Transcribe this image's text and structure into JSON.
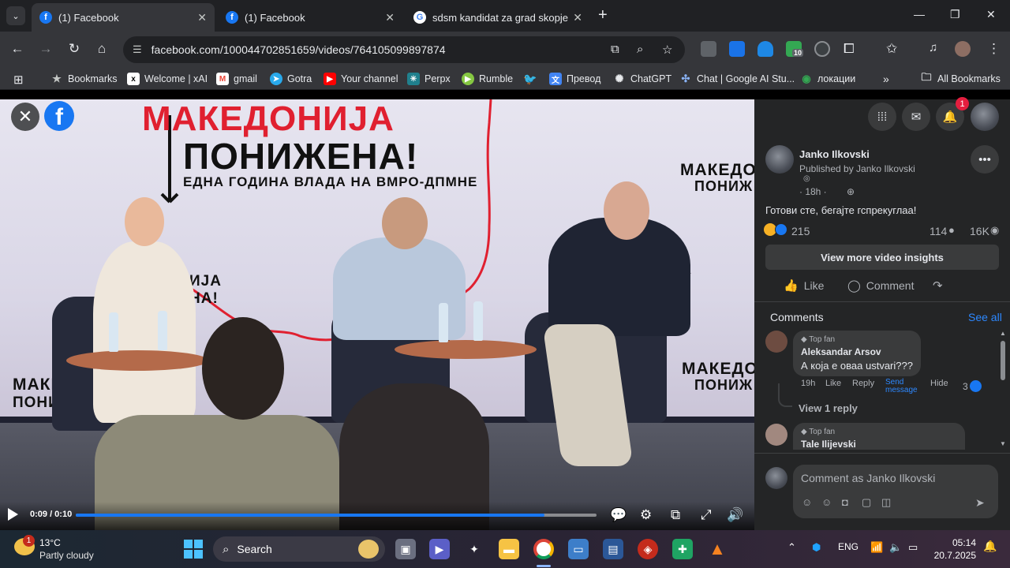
{
  "browser": {
    "tabs": [
      {
        "title": "(1) Facebook",
        "active": true
      },
      {
        "title": "(1) Facebook",
        "active": false
      },
      {
        "title": "sdsm kandidat za grad skopje -",
        "active": false
      }
    ],
    "url": "facebook.com/100044702851659/videos/764105099897874",
    "extension_badge": "10",
    "bookmarks": [
      {
        "label": "Bookmarks",
        "icon": "star-icon"
      },
      {
        "label": "Welcome | xAI",
        "icon": "xai-icon"
      },
      {
        "label": "gmail",
        "icon": "gmail-icon"
      },
      {
        "label": "Gotra",
        "icon": "telegram-icon"
      },
      {
        "label": "Your channel",
        "icon": "youtube-icon"
      },
      {
        "label": "Perpx",
        "icon": "perplexity-icon"
      },
      {
        "label": "Rumble",
        "icon": "rumble-icon"
      },
      {
        "label": "",
        "icon": "twitter-icon"
      },
      {
        "label": "Превод",
        "icon": "translate-icon"
      },
      {
        "label": "ChatGPT",
        "icon": "chatgpt-icon"
      },
      {
        "label": "Chat | Google AI Stu...",
        "icon": "google-ai-icon"
      },
      {
        "label": "локации",
        "icon": "maps-icon"
      }
    ],
    "all_bookmarks": "All Bookmarks"
  },
  "video": {
    "banner_line1": "МАКЕДОНИЈА",
    "banner_line2": "ПОНИЖЕНА!",
    "banner_line3": "ЕДНА ГОДИНА ВЛАДА НА ВМРО-ДПМНЕ",
    "side_text_1": "МАКЕДО",
    "side_text_2": "ПОНИЖ",
    "left_text_1": "МАКЕ",
    "left_text_2": "ПОНИ",
    "mid_text_1": "ИЈА",
    "mid_text_2": "НА!",
    "time": "0:09 / 0:10",
    "progress_fraction": 0.9
  },
  "panel": {
    "notification_count": "1",
    "author": "Janko Ilkovski",
    "published_by": "Published by Janko Ilkovski",
    "time": "· 18h ·",
    "post_text": "Готови сте, бегајте гспрекуглаа!",
    "reactions": "215",
    "comments_count": "114",
    "views": "16K",
    "insights_button": "View more video insights",
    "like": "Like",
    "comment": "Comment",
    "comments_header": "Comments",
    "see_all": "See all",
    "comments": [
      {
        "badge": "Top fan",
        "name": "Aleksandar Arsov",
        "text": "А која е оваа ustvari???",
        "time": "19h",
        "like": "Like",
        "reply": "Reply",
        "send": "Send message",
        "hide": "Hide",
        "reactions": "3"
      },
      {
        "badge": "Top fan",
        "name": "Tale Ilijevski"
      }
    ],
    "view_replies": "View 1 reply",
    "composer_placeholder": "Comment as Janko Ilkovski"
  },
  "taskbar": {
    "weather_badge": "1",
    "temperature": "13°C",
    "condition": "Partly cloudy",
    "search": "Search",
    "language": "ENG",
    "time": "05:14",
    "date": "20.7.2025"
  },
  "colors": {
    "facebook_blue": "#1877f2",
    "link_blue": "#2d88ff",
    "notification_red": "#e41e3f"
  }
}
